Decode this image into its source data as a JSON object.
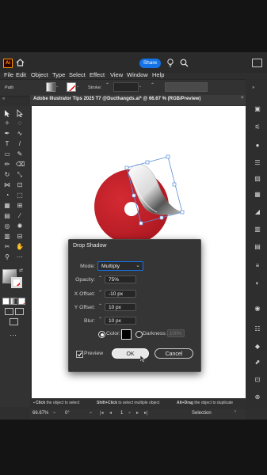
{
  "menu": {
    "items": [
      "File",
      "Edit",
      "Object",
      "Type",
      "Select",
      "Effect",
      "View",
      "Window",
      "Help"
    ],
    "share_label": "Share"
  },
  "controlbar": {
    "path_label": "Path",
    "stroke_label": "Stroke:"
  },
  "document": {
    "tab_title": "Adobe Illustrator Tips 2025 T7 @Ducthangds.ai* @ 66.67 % (RGB/Preview)"
  },
  "dialog": {
    "title": "Drop Shadow",
    "mode_label": "Mode:",
    "mode_value": "Multiply",
    "opacity_label": "Opacity:",
    "opacity_value": "75%",
    "x_offset_label": "X Offset:",
    "x_offset_value": "-10 px",
    "y_offset_label": "Y Offset:",
    "y_offset_value": "10 px",
    "blur_label": "Blur:",
    "blur_value": "10 px",
    "color_label": "Color:",
    "darkness_label": "Darkness:",
    "darkness_value": "100%",
    "preview_label": "Preview",
    "ok_label": "OK",
    "cancel_label": "Cancel",
    "preview_checked": true,
    "color_selected": true
  },
  "status": {
    "hint_1_key": "Click",
    "hint_1_text": "the object to select",
    "hint_2_key": "Shift+Click",
    "hint_2_text": "to select multiple object",
    "hint_3_key": "Alt+Drag",
    "hint_3_text": "the object to duplicate",
    "zoom": "66.67%",
    "rotation": "0°",
    "artboard_num": "1",
    "tool_name": "Selection"
  },
  "colors": {
    "shape_red": "#c4202a",
    "accent_blue": "#1473e6",
    "share_blue": "#1473e6"
  }
}
